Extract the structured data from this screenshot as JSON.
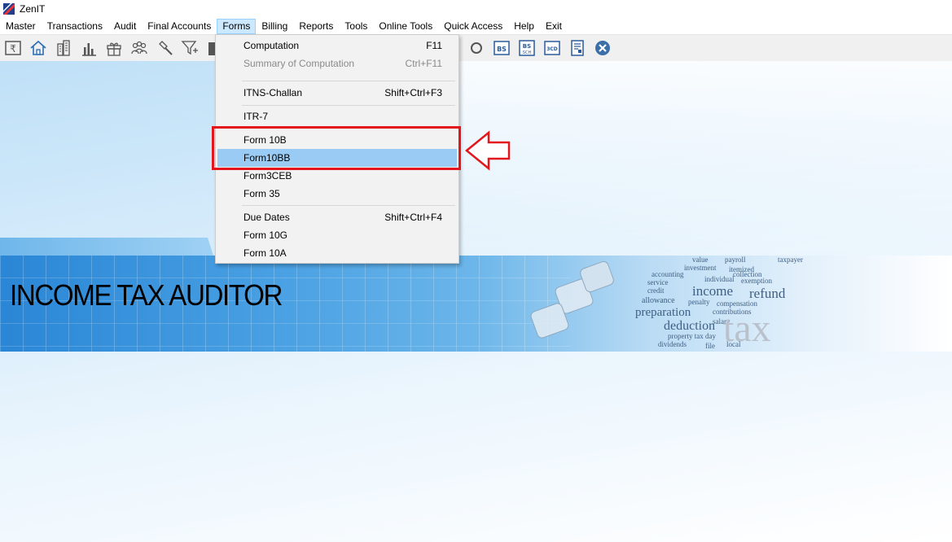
{
  "window": {
    "title": "ZenIT"
  },
  "menubar": {
    "items": [
      "Master",
      "Transactions",
      "Audit",
      "Final Accounts",
      "Forms",
      "Billing",
      "Reports",
      "Tools",
      "Online Tools",
      "Quick Access",
      "Help",
      "Exit"
    ],
    "active": "Forms"
  },
  "toolbar": {
    "icons": [
      "rupee-icon",
      "home-icon",
      "building-icon",
      "bar-chart-icon",
      "gift-icon",
      "users-icon",
      "hammer-icon",
      "filter-icon",
      "tax-icon"
    ],
    "right_icons": [
      "search-icon",
      "bs-icon",
      "bs-sch-icon",
      "3cd-icon",
      "form-icon",
      "close-circle-icon"
    ],
    "right_labels": {
      "bs": "BS",
      "bs_sch_top": "BS",
      "bs_sch_bottom": "SCH",
      "cd": "3CD"
    }
  },
  "banner": {
    "title": "INCOME TAX AUDITOR",
    "words": [
      "value",
      "investment",
      "payroll",
      "itemized",
      "taxpayer",
      "accounting",
      "service",
      "individual",
      "credit",
      "exemption",
      "collection",
      "income",
      "refund",
      "allowance",
      "penalty",
      "compensation",
      "preparation",
      "contributions",
      "deduction",
      "salary",
      "property tax day",
      "dividends",
      "local",
      "file",
      "tax"
    ]
  },
  "dropdown": {
    "items": [
      {
        "label": "Computation",
        "shortcut": "F11",
        "disabled": false
      },
      {
        "label": "Summary of Computation",
        "shortcut": "Ctrl+F11",
        "disabled": true
      },
      {
        "label": "ITNS-Challan",
        "shortcut": "Shift+Ctrl+F3",
        "disabled": false
      },
      {
        "label": "ITR-7",
        "shortcut": "",
        "disabled": false
      },
      {
        "label": "Form 10B",
        "shortcut": "",
        "disabled": false
      },
      {
        "label": "Form10BB",
        "shortcut": "",
        "disabled": false,
        "highlighted": true
      },
      {
        "label": "Form3CEB",
        "shortcut": "",
        "disabled": false
      },
      {
        "label": "Form 35",
        "shortcut": "",
        "disabled": false
      },
      {
        "label": "Due Dates",
        "shortcut": "Shift+Ctrl+F4",
        "disabled": false
      },
      {
        "label": "Form 10G",
        "shortcut": "",
        "disabled": false
      },
      {
        "label": "Form 10A",
        "shortcut": "",
        "disabled": false
      }
    ]
  },
  "colors": {
    "highlight_box": "#e3161e",
    "menu_hover": "#99cbf4",
    "active_menu": "#cce8ff"
  }
}
